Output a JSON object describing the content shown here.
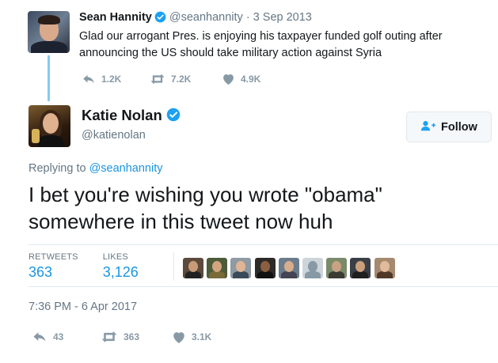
{
  "parent_tweet": {
    "name": "Sean Hannity",
    "handle": "@seanhannity",
    "separator": "·",
    "date": "3 Sep 2013",
    "text": "Glad our arrogant Pres. is enjoying his taxpayer funded golf outing after announcing the US should take military action against Syria",
    "replies": "1.2K",
    "retweets": "7.2K",
    "likes": "4.9K"
  },
  "main_tweet": {
    "name": "Katie Nolan",
    "handle": "@katienolan",
    "follow_label": "Follow",
    "replying_prefix": "Replying to",
    "replying_to": "@seanhannity",
    "text": "I bet you're wishing you wrote \"obama\" somewhere in this tweet now huh",
    "retweets_label": "RETWEETS",
    "retweets_count": "363",
    "likes_label": "LIKES",
    "likes_count": "3,126",
    "timestamp": "7:36 PM - 6 Apr 2017",
    "action_replies": "43",
    "action_retweets": "363",
    "action_likes": "3.1K"
  },
  "colors": {
    "accent": "#1b95e0",
    "muted": "#657786",
    "icon": "#8899a6",
    "thread_line": "#88c9f0"
  },
  "icons": [
    "verified-badge-icon",
    "reply-icon",
    "retweet-icon",
    "like-icon",
    "follow-person-icon"
  ]
}
